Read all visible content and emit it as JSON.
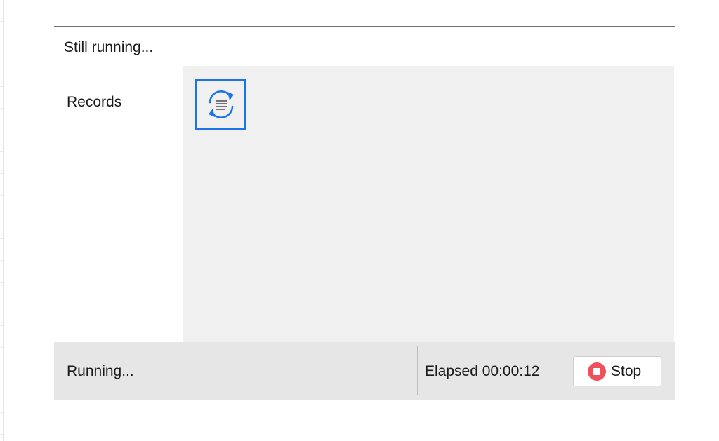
{
  "header": {
    "title": "Still running..."
  },
  "form": {
    "records_label": "Records",
    "record_icon": "sync-list-icon"
  },
  "status": {
    "text": "Running...",
    "elapsed": "Elapsed 00:00:12",
    "stop_label": "Stop",
    "stop_icon": "stop-icon"
  },
  "colors": {
    "accent": "#1a73e8",
    "stop": "#f0505b",
    "panel": "#f0f0f0",
    "statusbar": "#e6e6e6"
  }
}
